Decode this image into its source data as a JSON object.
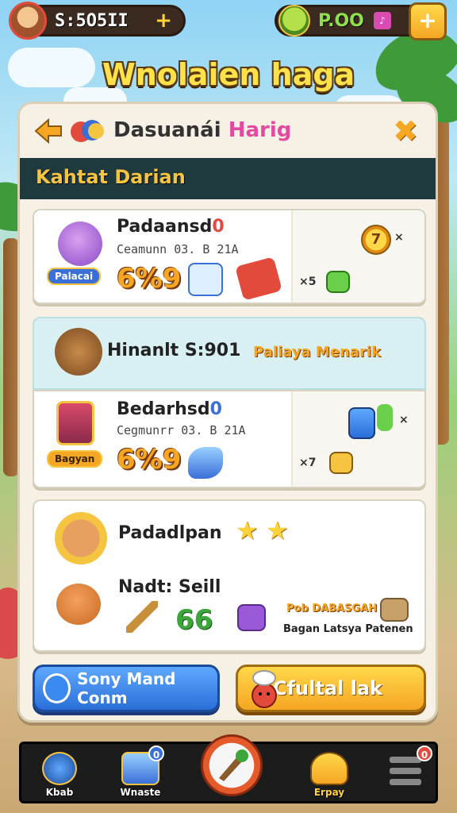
{
  "topbar": {
    "coins_value": "S:5O5II",
    "coins_plus": "+",
    "gems_value": "P.OO",
    "gems_box": "♪",
    "shop_label": "+"
  },
  "game_title": "Wnolaien haga",
  "panel": {
    "back_symbol": "➜",
    "title_main": "Dasuanái ",
    "title_highlight": "Harig",
    "close_symbol": "✖",
    "section_title": "Kahtat Darian"
  },
  "cards": [
    {
      "name": "Padaansd",
      "badge": "0",
      "subtitle": "Ceamunn 03. B 21A",
      "price": "6%9",
      "tag": "Palacai",
      "side_coin": "7",
      "side_coin_mult": "×",
      "side_mult": "×5"
    },
    {
      "banner_text": "Hinanlt S:901",
      "banner_highlight": "Paliaya Menarik",
      "name": "Bedarhsd",
      "badge": "0",
      "subtitle": "Cegmunrr 03. B 21A",
      "price": "6%9",
      "tag": "Bagyan",
      "side_mult": "×7",
      "side_top_mult": "×"
    },
    {
      "name": "Padadlpan",
      "stars": [
        "★",
        "★"
      ],
      "subname": "Nadt: Seill",
      "count": "66",
      "label_top": "Pob DABASGAH",
      "label_bottom": "Bagan Latsya Patenen"
    }
  ],
  "buttons": {
    "left": "Sony Mand Conm",
    "right": "Cfultal lak"
  },
  "nav": [
    {
      "label": "Kbab",
      "badge": ""
    },
    {
      "label": "Wnaste",
      "badge": "0"
    },
    {
      "label": "",
      "badge": ""
    },
    {
      "label": "Erpay",
      "badge": ""
    },
    {
      "label": "",
      "badge": "0"
    }
  ],
  "colors": {
    "accent_orange": "#f5a623",
    "accent_blue": "#2a6fd8",
    "section_bar": "#1f3a3f",
    "highlight_pink": "#e24aa0"
  }
}
